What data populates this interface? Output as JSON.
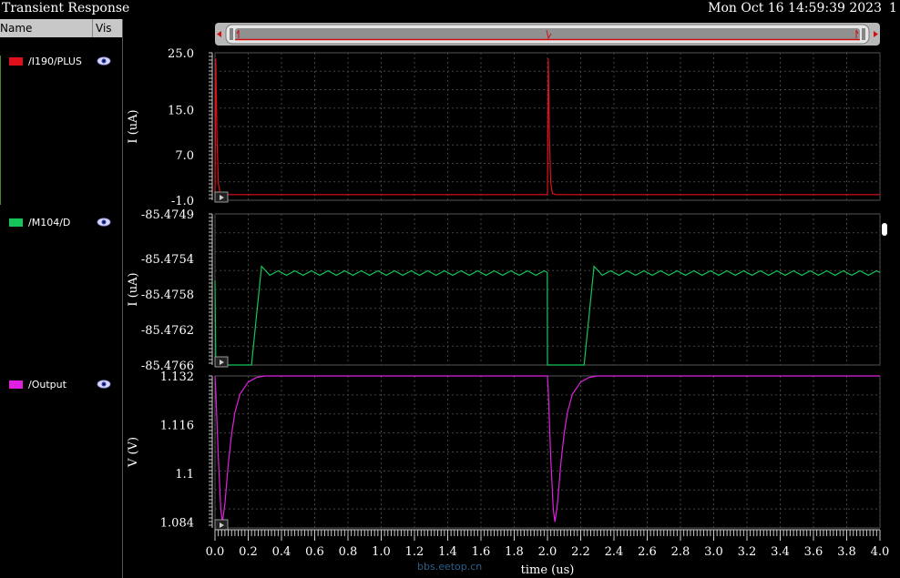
{
  "window": {
    "title": "Transient Response",
    "timestamp": "Mon Oct 16 14:59:39 2023",
    "page": "1"
  },
  "legend": {
    "header_name": "Name",
    "header_vis": "Vis",
    "items": [
      {
        "label": "/I190/PLUS",
        "color": "#e0101a"
      },
      {
        "label": "/M104/D",
        "color": "#16c55a"
      },
      {
        "label": "/Output",
        "color": "#e020e0"
      }
    ]
  },
  "watermark": "bbs.eetop.cn",
  "chart_data": [
    {
      "type": "line",
      "ylabel": "I (uA)",
      "ylim": [
        -1.0,
        25.0
      ],
      "yticks": [
        "25.0",
        "15.0",
        "7.0",
        "-1.0"
      ],
      "ytick_values": [
        25.0,
        15.0,
        7.0,
        -1.0
      ],
      "series": [
        {
          "name": "/I190/PLUS",
          "color": "#e0101a",
          "x": [
            0.0,
            0.005,
            0.012,
            0.02,
            0.03,
            0.05,
            2.0,
            2.005,
            2.012,
            2.02,
            2.03,
            2.05,
            4.0
          ],
          "y": [
            0.0,
            24.0,
            10.0,
            2.0,
            0.2,
            0.0,
            0.0,
            24.0,
            10.0,
            2.0,
            0.2,
            0.0,
            0.0
          ]
        }
      ]
    },
    {
      "type": "line",
      "ylabel": "I (uA)",
      "ylim": [
        -85.4766,
        -85.4749
      ],
      "yticks": [
        "-85.4749",
        "-85.4754",
        "-85.4758",
        "-85.4762",
        "-85.4766"
      ],
      "ytick_values": [
        -85.4749,
        -85.4754,
        -85.4758,
        -85.4762,
        -85.4766
      ],
      "series": [
        {
          "name": "/M104/D",
          "color": "#16c55a",
          "x": [
            0.0,
            0.005,
            0.22,
            0.28,
            0.33,
            0.38,
            0.43,
            0.48,
            0.53,
            0.58,
            0.63,
            0.68,
            0.73,
            0.78,
            0.83,
            0.88,
            0.93,
            0.98,
            1.03,
            1.08,
            1.13,
            1.18,
            1.23,
            1.28,
            1.33,
            1.38,
            1.43,
            1.48,
            1.53,
            1.58,
            1.63,
            1.68,
            1.73,
            1.78,
            1.83,
            1.88,
            1.93,
            1.98,
            1.999,
            2.0,
            2.005,
            2.22,
            2.28,
            2.33,
            2.38,
            2.43,
            2.48,
            2.53,
            2.58,
            2.63,
            2.68,
            2.73,
            2.78,
            2.83,
            2.88,
            2.93,
            2.98,
            3.03,
            3.08,
            3.13,
            3.18,
            3.23,
            3.28,
            3.33,
            3.38,
            3.43,
            3.48,
            3.53,
            3.58,
            3.63,
            3.68,
            3.73,
            3.78,
            3.83,
            3.88,
            3.93,
            3.98,
            4.0
          ],
          "y": [
            -85.47565,
            -85.4766,
            -85.4766,
            -85.47549,
            -85.47559,
            -85.47554,
            -85.47559,
            -85.47554,
            -85.47559,
            -85.47554,
            -85.47559,
            -85.47554,
            -85.47559,
            -85.47554,
            -85.47559,
            -85.47554,
            -85.47559,
            -85.47554,
            -85.47559,
            -85.47554,
            -85.47559,
            -85.47554,
            -85.47559,
            -85.47554,
            -85.47559,
            -85.47554,
            -85.47559,
            -85.47554,
            -85.47559,
            -85.47554,
            -85.47559,
            -85.47554,
            -85.47559,
            -85.47554,
            -85.47559,
            -85.47554,
            -85.47559,
            -85.47554,
            -85.47556,
            -85.4766,
            -85.4766,
            -85.4766,
            -85.47549,
            -85.47559,
            -85.47554,
            -85.47559,
            -85.47554,
            -85.47559,
            -85.47554,
            -85.47559,
            -85.47554,
            -85.47559,
            -85.47554,
            -85.47559,
            -85.47554,
            -85.47559,
            -85.47554,
            -85.47559,
            -85.47554,
            -85.47559,
            -85.47554,
            -85.47559,
            -85.47554,
            -85.47559,
            -85.47554,
            -85.47559,
            -85.47554,
            -85.47559,
            -85.47554,
            -85.47559,
            -85.47554,
            -85.47559,
            -85.47554,
            -85.47559,
            -85.47554,
            -85.47559,
            -85.47554,
            -85.47556
          ]
        }
      ]
    },
    {
      "type": "line",
      "ylabel": "V (V)",
      "ylim": [
        1.082,
        1.132
      ],
      "yticks": [
        "1.132",
        "1.116",
        "1.1",
        "1.084"
      ],
      "ytick_values": [
        1.132,
        1.116,
        1.1,
        1.084
      ],
      "xlabel": "time (us)",
      "xlim": [
        0.0,
        4.0
      ],
      "xticks": [
        "0.0",
        "0.2",
        "0.4",
        "0.6",
        "0.8",
        "1.0",
        "1.2",
        "1.4",
        "1.6",
        "1.8",
        "2.0",
        "2.2",
        "2.4",
        "2.6",
        "2.8",
        "3.0",
        "3.2",
        "3.4",
        "3.6",
        "3.8",
        "4.0"
      ],
      "series": [
        {
          "name": "/Output",
          "color": "#e020e0",
          "x": [
            0.0,
            0.005,
            0.02,
            0.035,
            0.045,
            0.06,
            0.08,
            0.1,
            0.12,
            0.15,
            0.2,
            0.25,
            0.3,
            0.35,
            2.0,
            2.005,
            2.02,
            2.035,
            2.045,
            2.06,
            2.08,
            2.1,
            2.12,
            2.15,
            2.2,
            2.25,
            2.3,
            2.35,
            4.0
          ],
          "y": [
            1.132,
            1.127,
            1.105,
            1.088,
            1.084,
            1.09,
            1.103,
            1.113,
            1.12,
            1.126,
            1.13,
            1.1315,
            1.132,
            1.132,
            1.132,
            1.127,
            1.105,
            1.088,
            1.084,
            1.09,
            1.103,
            1.113,
            1.12,
            1.126,
            1.13,
            1.1315,
            1.132,
            1.132,
            1.132
          ]
        }
      ]
    }
  ]
}
